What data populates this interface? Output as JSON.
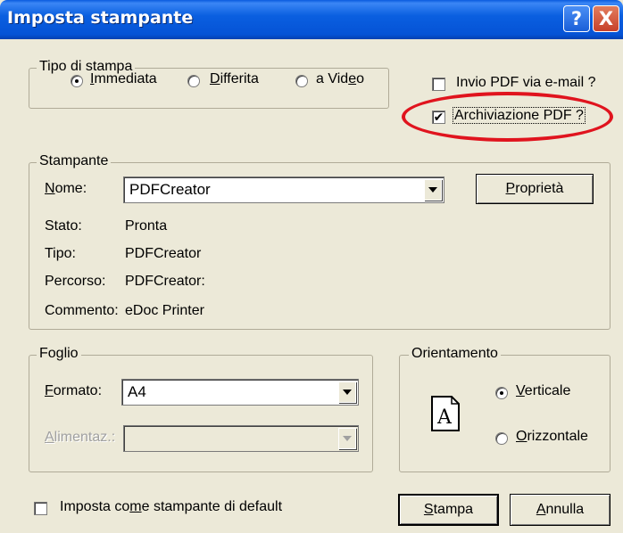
{
  "window": {
    "title": "Imposta stampante",
    "help_symbol": "?",
    "close_symbol": "X"
  },
  "print_type": {
    "legend": "Tipo di stampa",
    "options": [
      {
        "label_pre": "",
        "label_key": "I",
        "label_post": "mmediata",
        "selected": true
      },
      {
        "label_pre": "",
        "label_key": "D",
        "label_post": "ifferita",
        "selected": false
      },
      {
        "label_pre": "a Vid",
        "label_key": "e",
        "label_post": "o",
        "selected": false
      }
    ]
  },
  "options": {
    "email_pdf": {
      "label": "Invio PDF via e-mail ?",
      "checked": false
    },
    "archive_pdf": {
      "label": "Archiviazione PDF ?",
      "checked": true,
      "check_mark": "✔"
    }
  },
  "printer": {
    "legend": "Stampante",
    "name_label_key": "N",
    "name_label_rest": "ome:",
    "name_value": "PDFCreator",
    "properties_key": "P",
    "properties_rest": "roprietà",
    "info": [
      {
        "label": "Stato:",
        "value": "Pronta"
      },
      {
        "label": "Tipo:",
        "value": "PDFCreator"
      },
      {
        "label": "Percorso:",
        "value": "PDFCreator:"
      },
      {
        "label": "Commento:",
        "value": "eDoc Printer"
      }
    ]
  },
  "sheet": {
    "legend": "Foglio",
    "format_label_key": "F",
    "format_label_rest": "ormato:",
    "format_value": "A4",
    "feed_label_key": "A",
    "feed_label_rest": "limentaz.:",
    "feed_value": ""
  },
  "orientation": {
    "legend": "Orientamento",
    "icon_letter": "A",
    "portrait": {
      "label_key": "V",
      "label_rest": "erticale",
      "selected": true
    },
    "landscape": {
      "label_key": "O",
      "label_rest": "rizzontale",
      "selected": false
    }
  },
  "default_printer": {
    "label_pre": "Imposta co",
    "label_key": "m",
    "label_post": "e stampante di default",
    "checked": false
  },
  "buttons": {
    "print_key": "S",
    "print_rest": "tampa",
    "cancel_key": "A",
    "cancel_rest": "nnulla"
  },
  "colors": {
    "titlebar": "#0553d6",
    "dialog_bg": "#ece9d8",
    "highlight": "#e0141e"
  }
}
